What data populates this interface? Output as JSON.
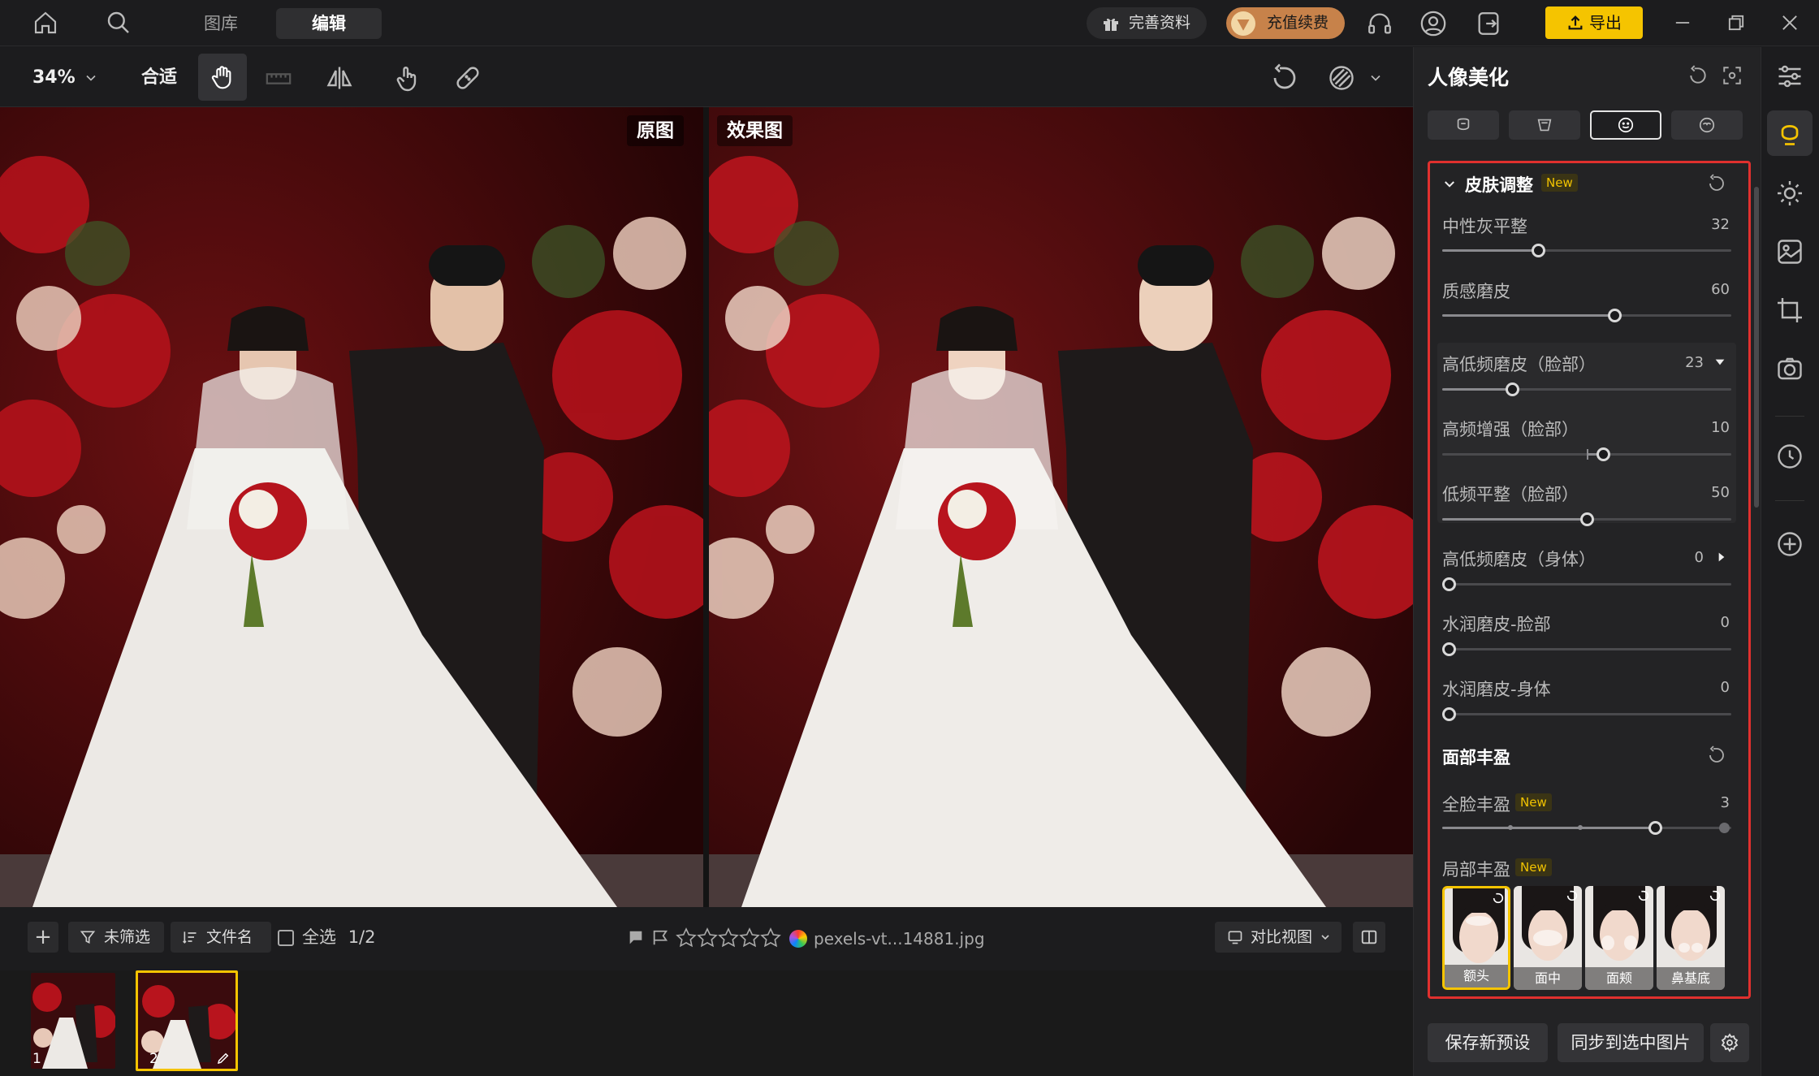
{
  "topbar": {
    "tabs": [
      "图库",
      "编辑"
    ],
    "complete_profile": "完善资料",
    "recharge": "充值续费",
    "export": "导出"
  },
  "toolbar": {
    "zoom": "34%",
    "fit": "合适"
  },
  "canvas": {
    "original_label": "原图",
    "effect_label": "效果图"
  },
  "bottom": {
    "add": "+",
    "filter": "未筛选",
    "sort": "文件名",
    "select_all": "全选",
    "count": "1/2",
    "filename": "pexels-vt...14881.jpg",
    "compare_view": "对比视图",
    "thumb_numbers": [
      "1",
      "2"
    ]
  },
  "panel": {
    "title": "人像美化",
    "skin_section": {
      "title": "皮肤调整",
      "new_tag": "New",
      "sliders": [
        {
          "label": "中性灰平整",
          "value": "32"
        },
        {
          "label": "质感磨皮",
          "value": "60"
        },
        {
          "label": "高低频磨皮（脸部）",
          "value": "23"
        },
        {
          "label": "高频增强（脸部）",
          "value": "10"
        },
        {
          "label": "低频平整（脸部）",
          "value": "50"
        },
        {
          "label": "高低频磨皮（身体）",
          "value": "0"
        },
        {
          "label": "水润磨皮-脸部",
          "value": "0"
        },
        {
          "label": "水润磨皮-身体",
          "value": "0"
        }
      ]
    },
    "face_section": {
      "title": "面部丰盈",
      "full_face": {
        "label": "全脸丰盈",
        "new_tag": "New",
        "value": "3"
      },
      "local": {
        "label": "局部丰盈",
        "new_tag": "New"
      },
      "thumbs": [
        "额头",
        "面中",
        "面颊",
        "鼻基底"
      ]
    },
    "save_preset": "保存新预设",
    "sync": "同步到选中图片"
  },
  "colors": {
    "accent_yellow": "#f5c400",
    "red_outline": "#e0302e",
    "bg": "#1c1c1e"
  }
}
